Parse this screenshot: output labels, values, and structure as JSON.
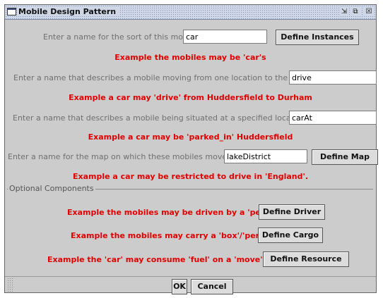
{
  "window": {
    "title": "Mobile Design Pattern",
    "controls": [
      "⇲",
      "⧉",
      "☒"
    ]
  },
  "sort": {
    "label": "Enter a name for the sort of this mobile",
    "value": "car",
    "button": "Define Instances",
    "example": "Example the mobiles may be 'car's"
  },
  "move": {
    "label": "Enter a name that describes a mobile moving from one location to the next",
    "value": "drive",
    "example": "Example a car may 'drive' from Huddersfield to Durham"
  },
  "situated": {
    "label": "Enter a name that describes a mobile being situated at a specified location",
    "value": "carAt",
    "example": "Example a car may be 'parked_in' Huddersfield"
  },
  "map": {
    "label": "Enter a name for the map on which these mobiles move.",
    "value": "lakeDistrict",
    "button": "Define Map",
    "example": "Example a car may be restricted to drive in 'England'."
  },
  "optional": {
    "title": "Optional Components",
    "driver": {
      "text": "Example the mobiles may be driven by a 'person'",
      "button": "Define Driver"
    },
    "cargo": {
      "text": "Example the mobiles may carry a 'box'/'person'",
      "button": "Define Cargo"
    },
    "resource": {
      "text": "Example the 'car' may consume 'fuel' on a 'move' action.",
      "button": "Define Resource"
    }
  },
  "footer": {
    "ok": "OK",
    "cancel": "Cancel"
  }
}
